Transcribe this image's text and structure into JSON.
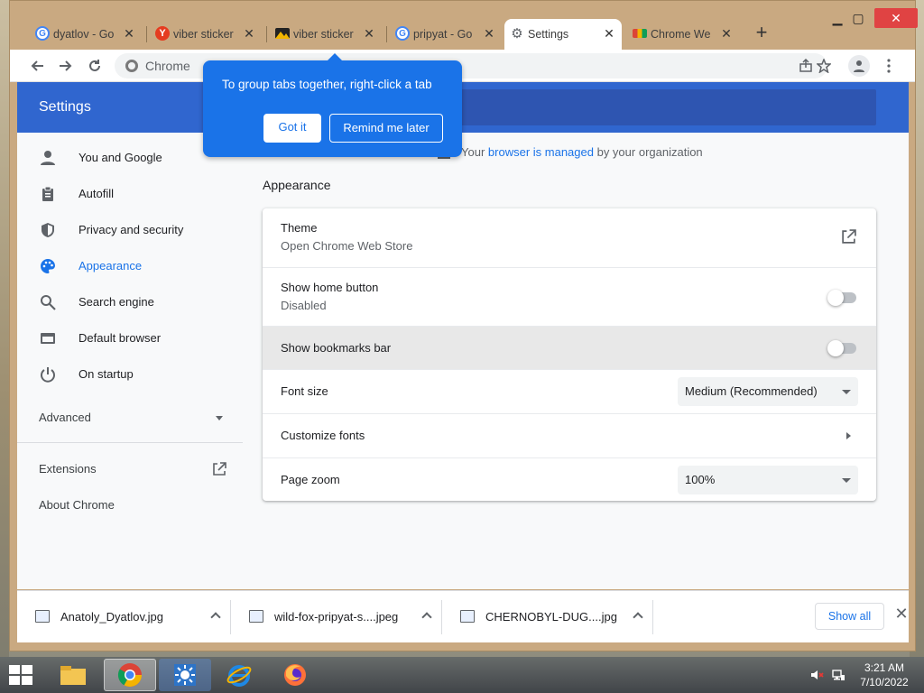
{
  "tabs": [
    {
      "label": "dyatlov - Go",
      "favicon": "google-g"
    },
    {
      "label": "viber sticker",
      "favicon": "yandex-y"
    },
    {
      "label": "viber sticker",
      "favicon": "image-thumbnail"
    },
    {
      "label": "pripyat - Go",
      "favicon": "google-g"
    },
    {
      "label": "Settings",
      "favicon": "gear"
    },
    {
      "label": "Chrome We",
      "favicon": "chrome-web-store"
    }
  ],
  "omnibox": {
    "text": "Chrome"
  },
  "promo": {
    "text": "To group tabs together, right-click a tab",
    "got_it": "Got it",
    "remind_later": "Remind me later"
  },
  "settings": {
    "title": "Settings",
    "nav": [
      {
        "label": "You and Google",
        "icon": "person-icon"
      },
      {
        "label": "Autofill",
        "icon": "clipboard-icon"
      },
      {
        "label": "Privacy and security",
        "icon": "shield-icon"
      },
      {
        "label": "Appearance",
        "icon": "palette-icon"
      },
      {
        "label": "Search engine",
        "icon": "search-icon"
      },
      {
        "label": "Default browser",
        "icon": "browser-window-icon"
      },
      {
        "label": "On startup",
        "icon": "power-icon"
      }
    ],
    "advanced": "Advanced",
    "extensions": "Extensions",
    "about": "About Chrome",
    "managed_prefix": "Your",
    "managed_link": "browser is managed",
    "managed_suffix": "by your organization",
    "section": "Appearance",
    "rows": {
      "theme_label": "Theme",
      "theme_sub": "Open Chrome Web Store",
      "home_label": "Show home button",
      "home_sub": "Disabled",
      "bookmarks_label": "Show bookmarks bar",
      "fontsize_label": "Font size",
      "fontsize_value": "Medium (Recommended)",
      "customfonts_label": "Customize fonts",
      "zoom_label": "Page zoom",
      "zoom_value": "100%"
    }
  },
  "downloads": [
    {
      "name": "Anatoly_Dyatlov.jpg"
    },
    {
      "name": "wild-fox-pripyat-s....jpeg"
    },
    {
      "name": "CHERNOBYL-DUG....jpg"
    }
  ],
  "shelf": {
    "show_all": "Show all"
  },
  "clock": {
    "time": "3:21 AM",
    "date": "7/10/2022"
  },
  "colors": {
    "accent": "#1a73e8",
    "header": "#3066cf",
    "window_frame": "#c9a981"
  }
}
